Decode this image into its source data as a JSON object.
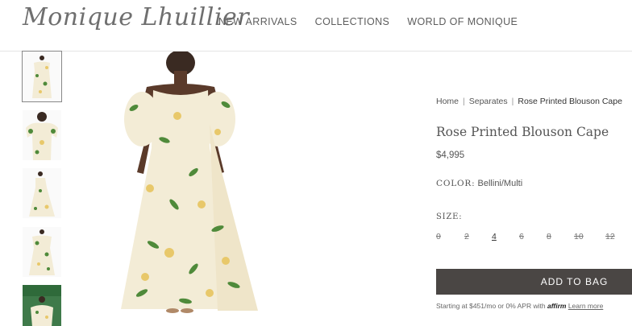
{
  "brand": {
    "logo_text": "Monique Lhuillier"
  },
  "nav": {
    "items": [
      "NEW ARRIVALS",
      "COLLECTIONS",
      "WORLD OF MONIQUE"
    ]
  },
  "breadcrumb": {
    "home": "Home",
    "section": "Separates",
    "current": "Rose Printed Blouson Cape",
    "separator": "|"
  },
  "product": {
    "title": "Rose Printed Blouson Cape",
    "price": "$4,995",
    "color_label": "COLOR:",
    "color_value": "Bellini/Multi",
    "size_label": "SIZE:",
    "sizes": [
      {
        "label": "0",
        "available": false
      },
      {
        "label": "2",
        "available": false
      },
      {
        "label": "4",
        "available": true
      },
      {
        "label": "6",
        "available": false
      },
      {
        "label": "8",
        "available": false
      },
      {
        "label": "10",
        "available": false
      },
      {
        "label": "12",
        "available": false
      }
    ],
    "add_to_bag": "ADD TO BAG"
  },
  "financing": {
    "text": "Starting at $451/mo or 0% APR with",
    "brand": "affirm",
    "link": "Learn more"
  },
  "colors": {
    "dress_base": "#f3ecd6",
    "leaf_green": "#4f8a3a",
    "flower_yellow": "#e8c86a",
    "button_bg": "#4a4644"
  }
}
